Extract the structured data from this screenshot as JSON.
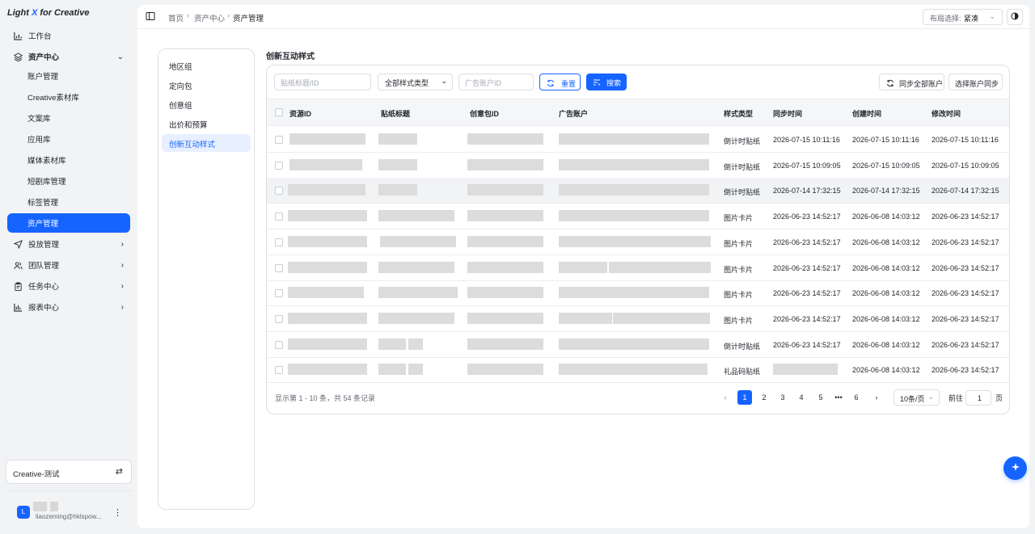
{
  "app": {
    "logo_prefix": "Light ",
    "logo_x": "X",
    "logo_suffix": " for Creative"
  },
  "sidebar": {
    "workbench": "工作台",
    "asset_center": "资产中心",
    "sub_items": [
      "账户管理",
      "Creative素材库",
      "文案库",
      "应用库",
      "媒体素材库",
      "短剧库管理",
      "标签管理",
      "资产管理"
    ],
    "groups": [
      "投放管理",
      "团队管理",
      "任务中心",
      "报表中心"
    ],
    "workspace": "Creative-测试",
    "avatar_letter": "L",
    "email": "liaozeming@hklspow..."
  },
  "breadcrumb": {
    "home": "首页",
    "level1": "资产中心",
    "current": "资产管理"
  },
  "layout": {
    "label": "布局选择:",
    "value": "紧凑"
  },
  "subnav": [
    "地区组",
    "定向包",
    "创意组",
    "出价和预算",
    "创新互动样式"
  ],
  "section_title": "创新互动样式",
  "filters": {
    "title_placeholder": "贴纸标题/ID",
    "type_value": "全部样式类型",
    "account_placeholder": "广告账户ID",
    "reset_label": "重置",
    "search_label": "搜索",
    "sync_all_label": "同步全部账户",
    "select_sync_label": "选择账户同步"
  },
  "table": {
    "headers": [
      "资源ID",
      "贴纸标题",
      "创意包ID",
      "广告账户",
      "样式类型",
      "同步时间",
      "创建时间",
      "修改时间"
    ],
    "rows": [
      {
        "type": "倒计时贴纸",
        "sync": "2026-07-15 10:11:16",
        "created": "2026-07-15 10:11:16",
        "modified": "2026-07-15 10:11:16"
      },
      {
        "type": "倒计时贴纸",
        "sync": "2026-07-15 10:09:05",
        "created": "2026-07-15 10:09:05",
        "modified": "2026-07-15 10:09:05"
      },
      {
        "type": "倒计时贴纸",
        "sync": "2026-07-14 17:32:15",
        "created": "2026-07-14 17:32:15",
        "modified": "2026-07-14 17:32:15"
      },
      {
        "type": "图片卡片",
        "sync": "2026-06-23 14:52:17",
        "created": "2026-06-08 14:03:12",
        "modified": "2026-06-23 14:52:17"
      },
      {
        "type": "图片卡片",
        "sync": "2026-06-23 14:52:17",
        "created": "2026-06-08 14:03:12",
        "modified": "2026-06-23 14:52:17"
      },
      {
        "type": "图片卡片",
        "sync": "2026-06-23 14:52:17",
        "created": "2026-06-08 14:03:12",
        "modified": "2026-06-23 14:52:17"
      },
      {
        "type": "图片卡片",
        "sync": "2026-06-23 14:52:17",
        "created": "2026-06-08 14:03:12",
        "modified": "2026-06-23 14:52:17"
      },
      {
        "type": "图片卡片",
        "sync": "2026-06-23 14:52:17",
        "created": "2026-06-08 14:03:12",
        "modified": "2026-06-23 14:52:17"
      },
      {
        "type": "倒计时贴纸",
        "sync": "2026-06-23 14:52:17",
        "created": "2026-06-08 14:03:12",
        "modified": "2026-06-23 14:52:17"
      },
      {
        "type": "礼品码贴纸",
        "sync": "",
        "created": "2026-06-08 14:03:12",
        "modified": "2026-06-23 14:52:17"
      }
    ]
  },
  "pagination": {
    "info": "显示第 1 - 10 条，共 54 条记录",
    "pages": [
      "1",
      "2",
      "3",
      "4",
      "5",
      "•••",
      "6"
    ],
    "current_page": "1",
    "page_size": "10条/页",
    "goto_prefix": "前往",
    "goto_value": "1",
    "goto_suffix": "页"
  },
  "colors": {
    "accent": "#1664ff",
    "sidebar_bg": "#f2f3f5",
    "redacted": "#dcdcdc"
  }
}
